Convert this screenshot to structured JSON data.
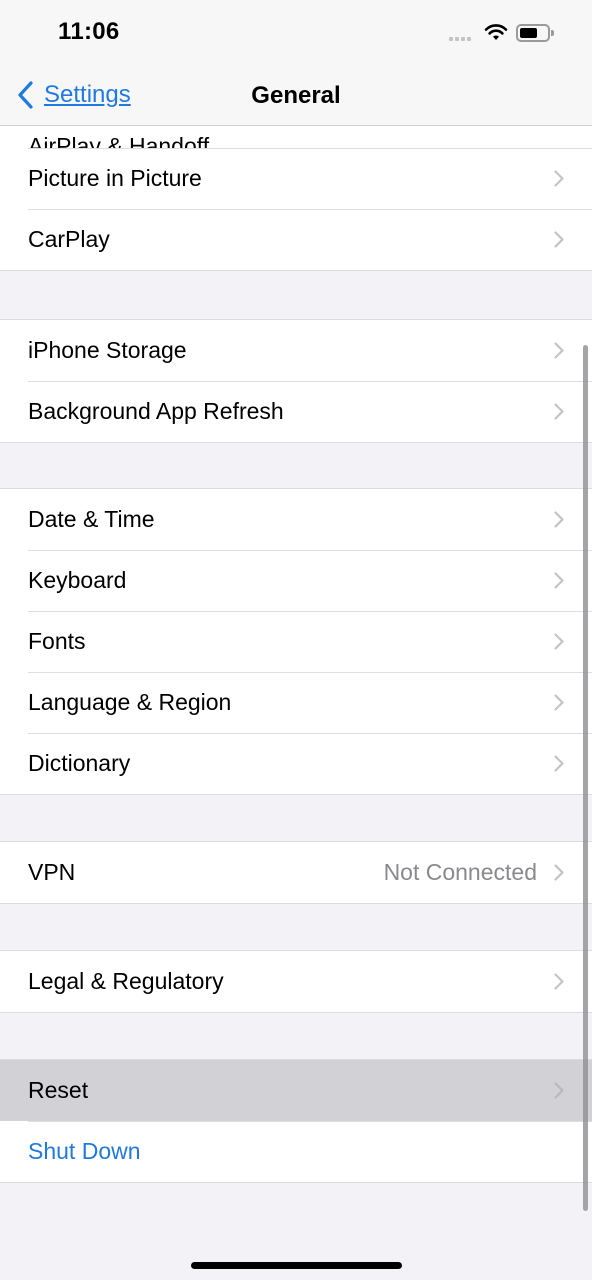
{
  "status_bar": {
    "time": "11:06",
    "signal_icon": "cellular-signal-icon",
    "wifi_icon": "wifi-icon",
    "battery_icon": "battery-icon",
    "battery_level_fraction": 0.5
  },
  "nav": {
    "back_label": "Settings",
    "back_icon": "chevron-left-icon",
    "title": "General"
  },
  "groups": [
    {
      "rows": [
        {
          "label": "AirPlay & Handoff",
          "partial": true
        },
        {
          "label": "Picture in Picture"
        },
        {
          "label": "CarPlay"
        }
      ]
    },
    {
      "rows": [
        {
          "label": "iPhone Storage"
        },
        {
          "label": "Background App Refresh"
        }
      ]
    },
    {
      "rows": [
        {
          "label": "Date & Time"
        },
        {
          "label": "Keyboard"
        },
        {
          "label": "Fonts"
        },
        {
          "label": "Language & Region"
        },
        {
          "label": "Dictionary"
        }
      ]
    },
    {
      "rows": [
        {
          "label": "VPN",
          "value": "Not Connected"
        }
      ]
    },
    {
      "rows": [
        {
          "label": "Legal & Regulatory"
        }
      ]
    },
    {
      "rows": [
        {
          "label": "Reset",
          "highlighted": true
        },
        {
          "label": "Shut Down",
          "action": true
        }
      ]
    }
  ],
  "colors": {
    "accent": "#1f7ae0",
    "background": "#f2f2f7",
    "highlight": "#d1d1d6",
    "secondary_text": "#8a8a8e"
  }
}
